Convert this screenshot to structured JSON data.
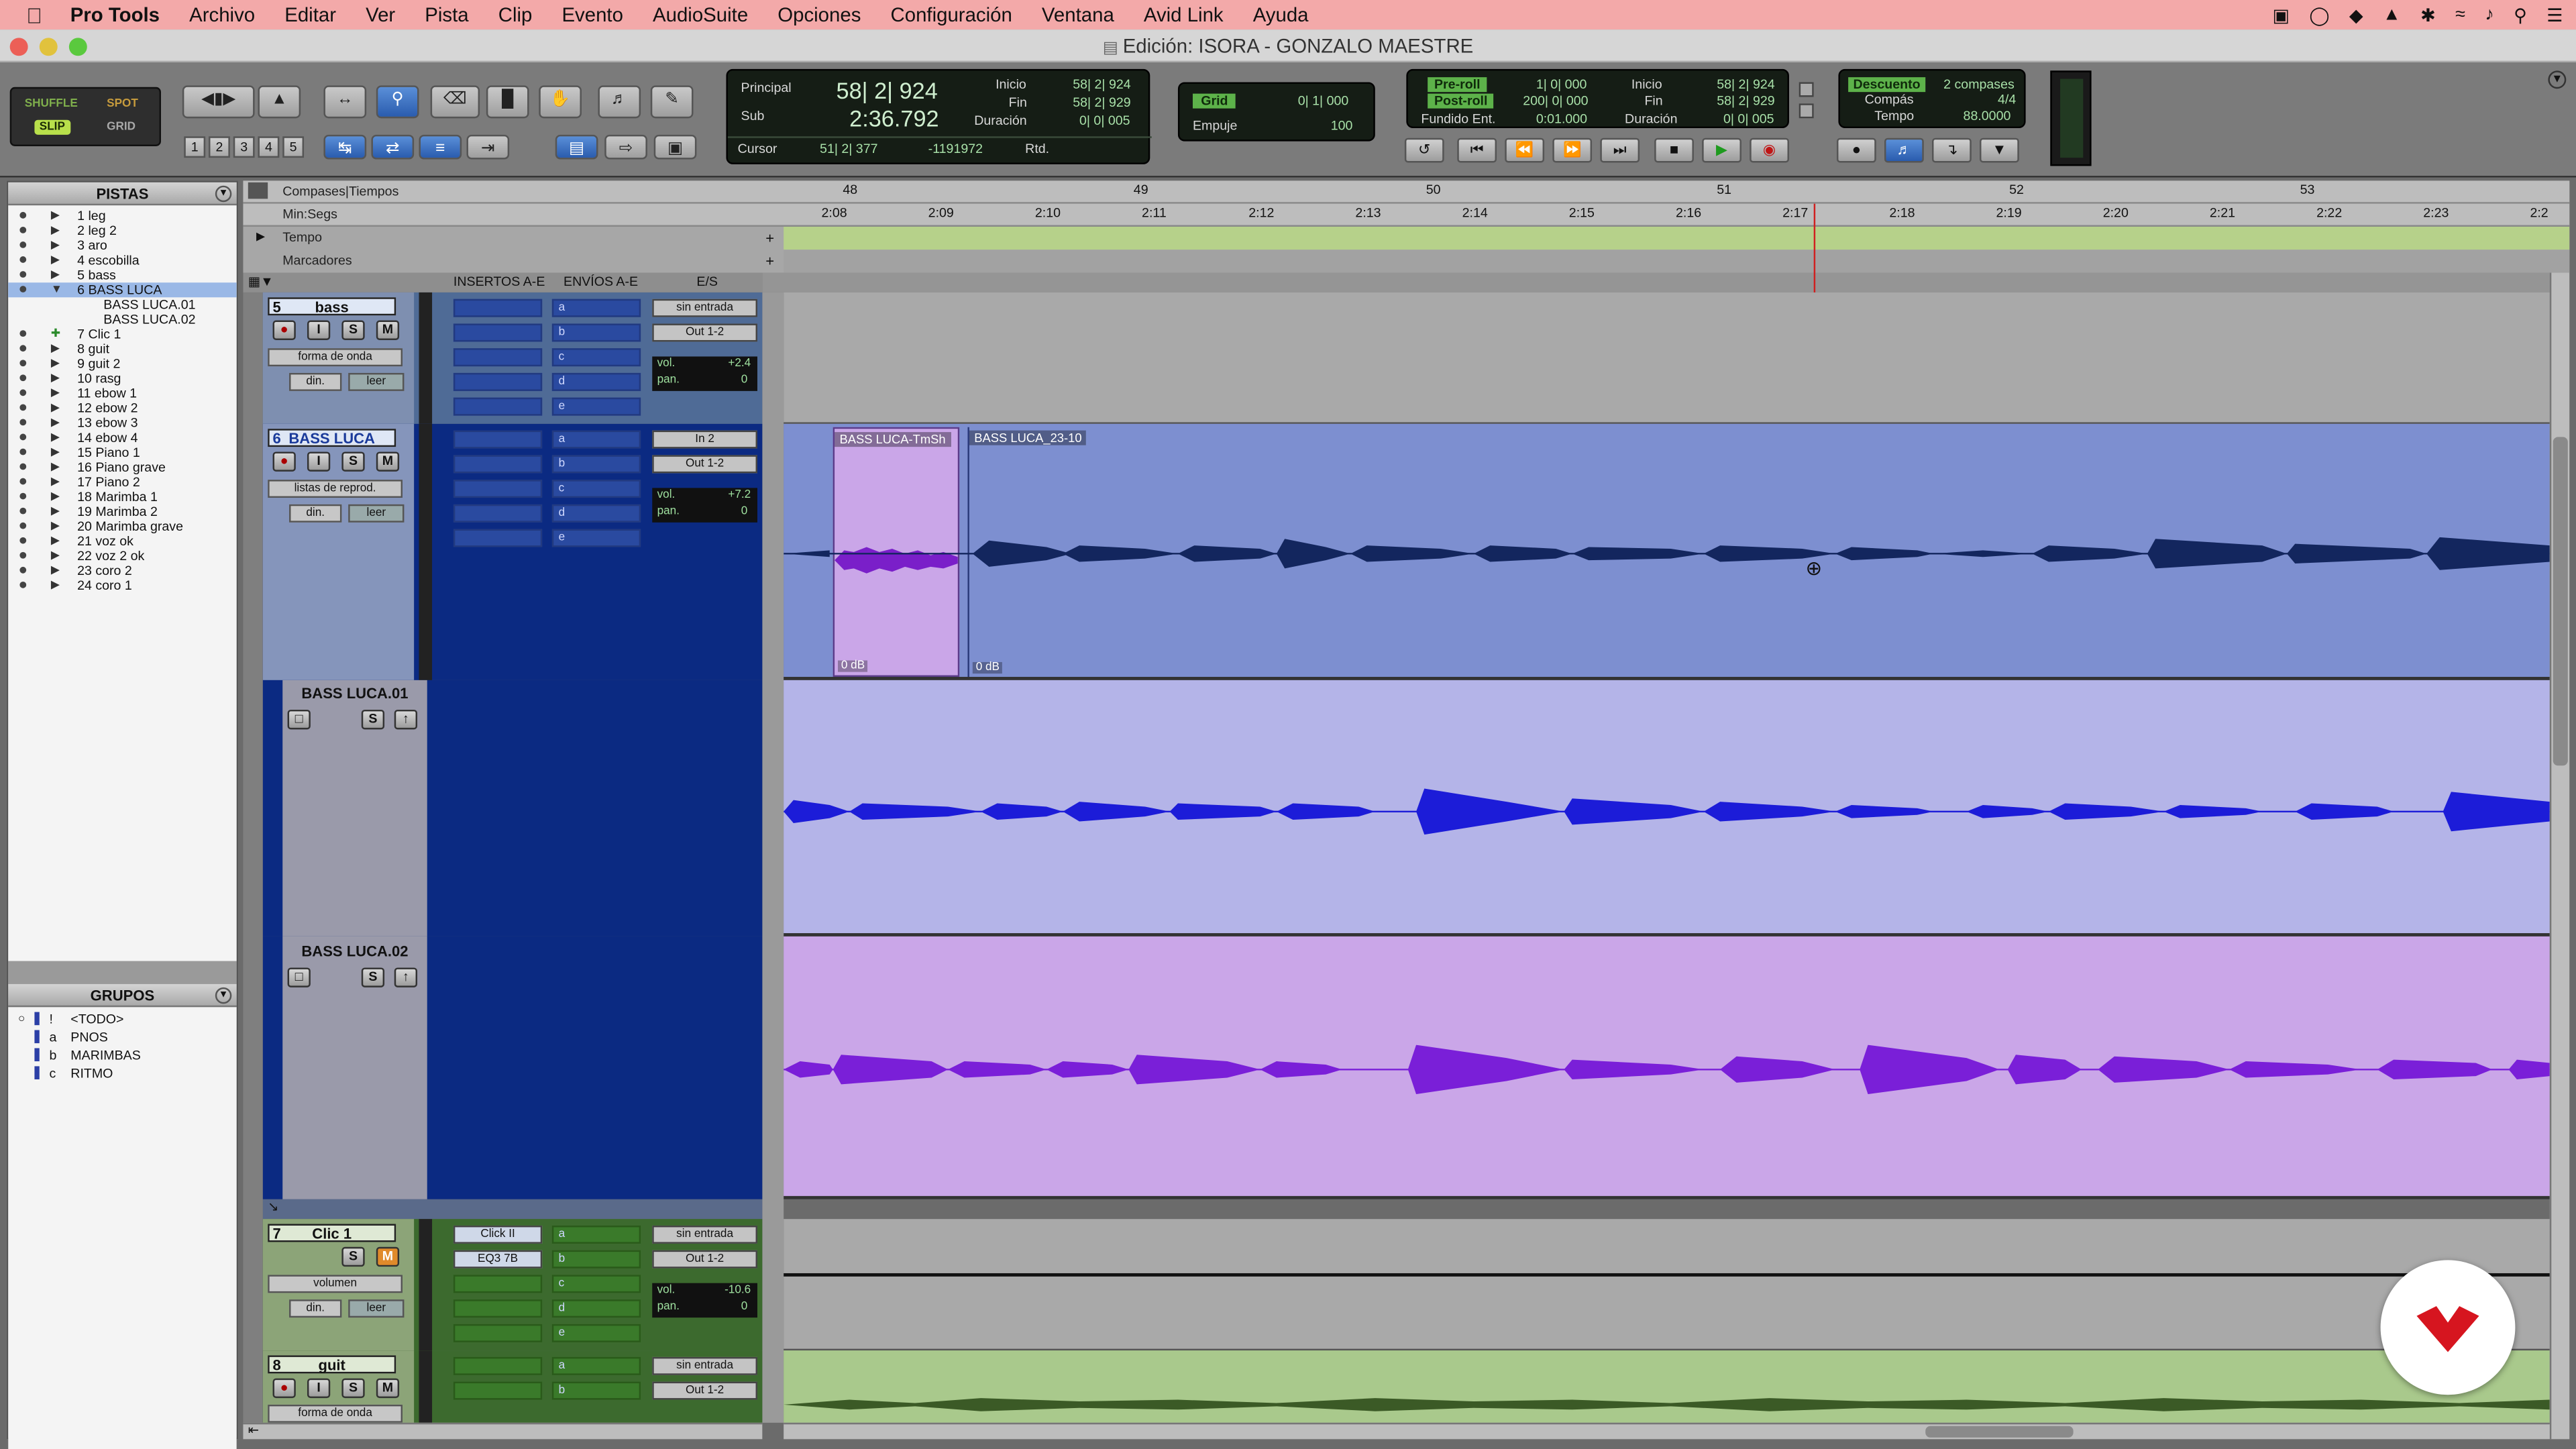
{
  "menubar": {
    "app": "Pro Tools",
    "items": [
      "Archivo",
      "Editar",
      "Ver",
      "Pista",
      "Clip",
      "Evento",
      "AudioSuite",
      "Opciones",
      "Configuración",
      "Ventana",
      "Avid Link",
      "Ayuda"
    ]
  },
  "window": {
    "title": "Edición: ISORA - GONZALO MAESTRE"
  },
  "modes": {
    "shuffle": "SHUFFLE",
    "spot": "SPOT",
    "slip": "SLIP",
    "grid": "GRID"
  },
  "zoom_presets": [
    "1",
    "2",
    "3",
    "4",
    "5"
  ],
  "counters": {
    "principal_label": "Principal",
    "principal_value": "58| 2| 924",
    "sub_label": "Sub",
    "sub_value": "2:36.792",
    "inicio_label": "Inicio",
    "inicio_value": "58| 2| 924",
    "fin_label": "Fin",
    "fin_value": "58| 2| 929",
    "duracion_label": "Duración",
    "duracion_value": "0| 0| 005",
    "cursor_label": "Cursor",
    "cursor_value": "51| 2| 377",
    "cursor_sample": "-1191972",
    "rtd_label": "Rtd."
  },
  "grid": {
    "label": "Grid",
    "value": "0| 1| 000",
    "nudge_label": "Empuje",
    "nudge_value": "100"
  },
  "transport_counters": {
    "preroll_label": "Pre-roll",
    "preroll_value": "1| 0| 000",
    "postroll_label": "Post-roll",
    "postroll_value": "200| 0| 000",
    "fade_label": "Fundido Ent.",
    "fade_value": "0:01.000",
    "inicio_label": "Inicio",
    "inicio_value": "58| 2| 924",
    "fin_label": "Fin",
    "fin_value": "58| 2| 929",
    "duracion_label": "Duración",
    "duracion_value": "0| 0| 005"
  },
  "countoff": {
    "label": "Descuento",
    "bars": "2 compases",
    "meter_label": "Compás",
    "meter_value": "4/4",
    "tempo_label": "Tempo",
    "tempo_value": "88.0000"
  },
  "left_panel": {
    "tracks_title": "PISTAS",
    "tracks": [
      {
        "name": "1 leg"
      },
      {
        "name": "2 leg 2"
      },
      {
        "name": "3 aro"
      },
      {
        "name": "4 escobilla"
      },
      {
        "name": "5 bass"
      },
      {
        "name": "6 BASS LUCA",
        "selected": true
      },
      {
        "name": "BASS LUCA.01",
        "sub": true
      },
      {
        "name": "BASS LUCA.02",
        "sub": true
      },
      {
        "name": "7 Clic 1"
      },
      {
        "name": "8 guit"
      },
      {
        "name": "9 guit 2"
      },
      {
        "name": "10 rasg"
      },
      {
        "name": "11 ebow 1"
      },
      {
        "name": "12 ebow 2"
      },
      {
        "name": "13 ebow 3"
      },
      {
        "name": "14 ebow 4"
      },
      {
        "name": "15 Piano 1"
      },
      {
        "name": "16 Piano grave"
      },
      {
        "name": "17 Piano 2"
      },
      {
        "name": "18 Marimba 1"
      },
      {
        "name": "19 Marimba 2"
      },
      {
        "name": "20 Marimba grave"
      },
      {
        "name": "21 voz ok"
      },
      {
        "name": "22 voz 2 ok"
      },
      {
        "name": "23 coro 2"
      },
      {
        "name": "24 coro 1"
      }
    ],
    "groups_title": "GRUPOS",
    "groups": [
      {
        "id": "!",
        "name": "<TODO>"
      },
      {
        "id": "a",
        "name": "PNOS"
      },
      {
        "id": "b",
        "name": "MARIMBAS"
      },
      {
        "id": "c",
        "name": "RITMO"
      }
    ]
  },
  "rulers": {
    "compases_label": "Compases|Tiempos",
    "minsegs_label": "Min:Segs",
    "tempo_label": "Tempo",
    "markers_label": "Marcadores",
    "bars": [
      "48",
      "49",
      "50",
      "51",
      "52",
      "53"
    ],
    "times": [
      "2:08",
      "2:09",
      "2:10",
      "2:11",
      "2:12",
      "2:13",
      "2:14",
      "2:15",
      "2:16",
      "2:17",
      "2:18",
      "2:19",
      "2:20",
      "2:21",
      "2:22",
      "2:23",
      "2:2"
    ]
  },
  "columns": {
    "inserts": "INSERTOS A-E",
    "sends": "ENVÍOS A-E",
    "io": "E/S"
  },
  "tracks": {
    "bass": {
      "number": "5",
      "name": "bass",
      "view": "forma de onda",
      "auto": "din.",
      "auto_mode": "leer",
      "input": "sin entrada",
      "output": "Out 1-2",
      "vol_label": "vol.",
      "vol": "+2.4",
      "pan_label": "pan.",
      "pan": "0"
    },
    "bass_luca": {
      "number": "6",
      "name": "BASS LUCA",
      "view": "listas de reprod.",
      "auto": "din.",
      "auto_mode": "leer",
      "input": "In 2",
      "output": "Out 1-2",
      "vol_label": "vol.",
      "vol": "+7.2",
      "pan_label": "pan.",
      "pan": "0",
      "clip1": "BASS LUCA-TmSh",
      "clip2": "BASS LUCA_23-10",
      "gain1": "0 dB",
      "gain2": "0 dB"
    },
    "pl1": {
      "name": "BASS LUCA.01"
    },
    "pl2": {
      "name": "BASS LUCA.02"
    },
    "clic": {
      "number": "7",
      "name": "Clic 1",
      "view": "volumen",
      "auto": "din.",
      "auto_mode": "leer",
      "insert1": "Click II",
      "insert2": "EQ3 7B",
      "input": "sin entrada",
      "output": "Out 1-2",
      "vol_label": "vol.",
      "vol": "-10.6",
      "pan_label": "pan.",
      "pan": "0"
    },
    "guit": {
      "number": "8",
      "name": "guit",
      "view": "forma de onda",
      "input": "sin entrada",
      "output": "Out 1-2"
    }
  },
  "send_slots": [
    "a",
    "b",
    "c",
    "d",
    "e"
  ],
  "colors": {
    "menubar": "#f3a9a9",
    "bass_luca_lane": "#7d8fd0",
    "pl1_lane": "#b4b4e8",
    "pl2_lane": "#caa6e8",
    "guit_lane": "#a9c98c",
    "ruler_tempo": "#b6d18a"
  }
}
